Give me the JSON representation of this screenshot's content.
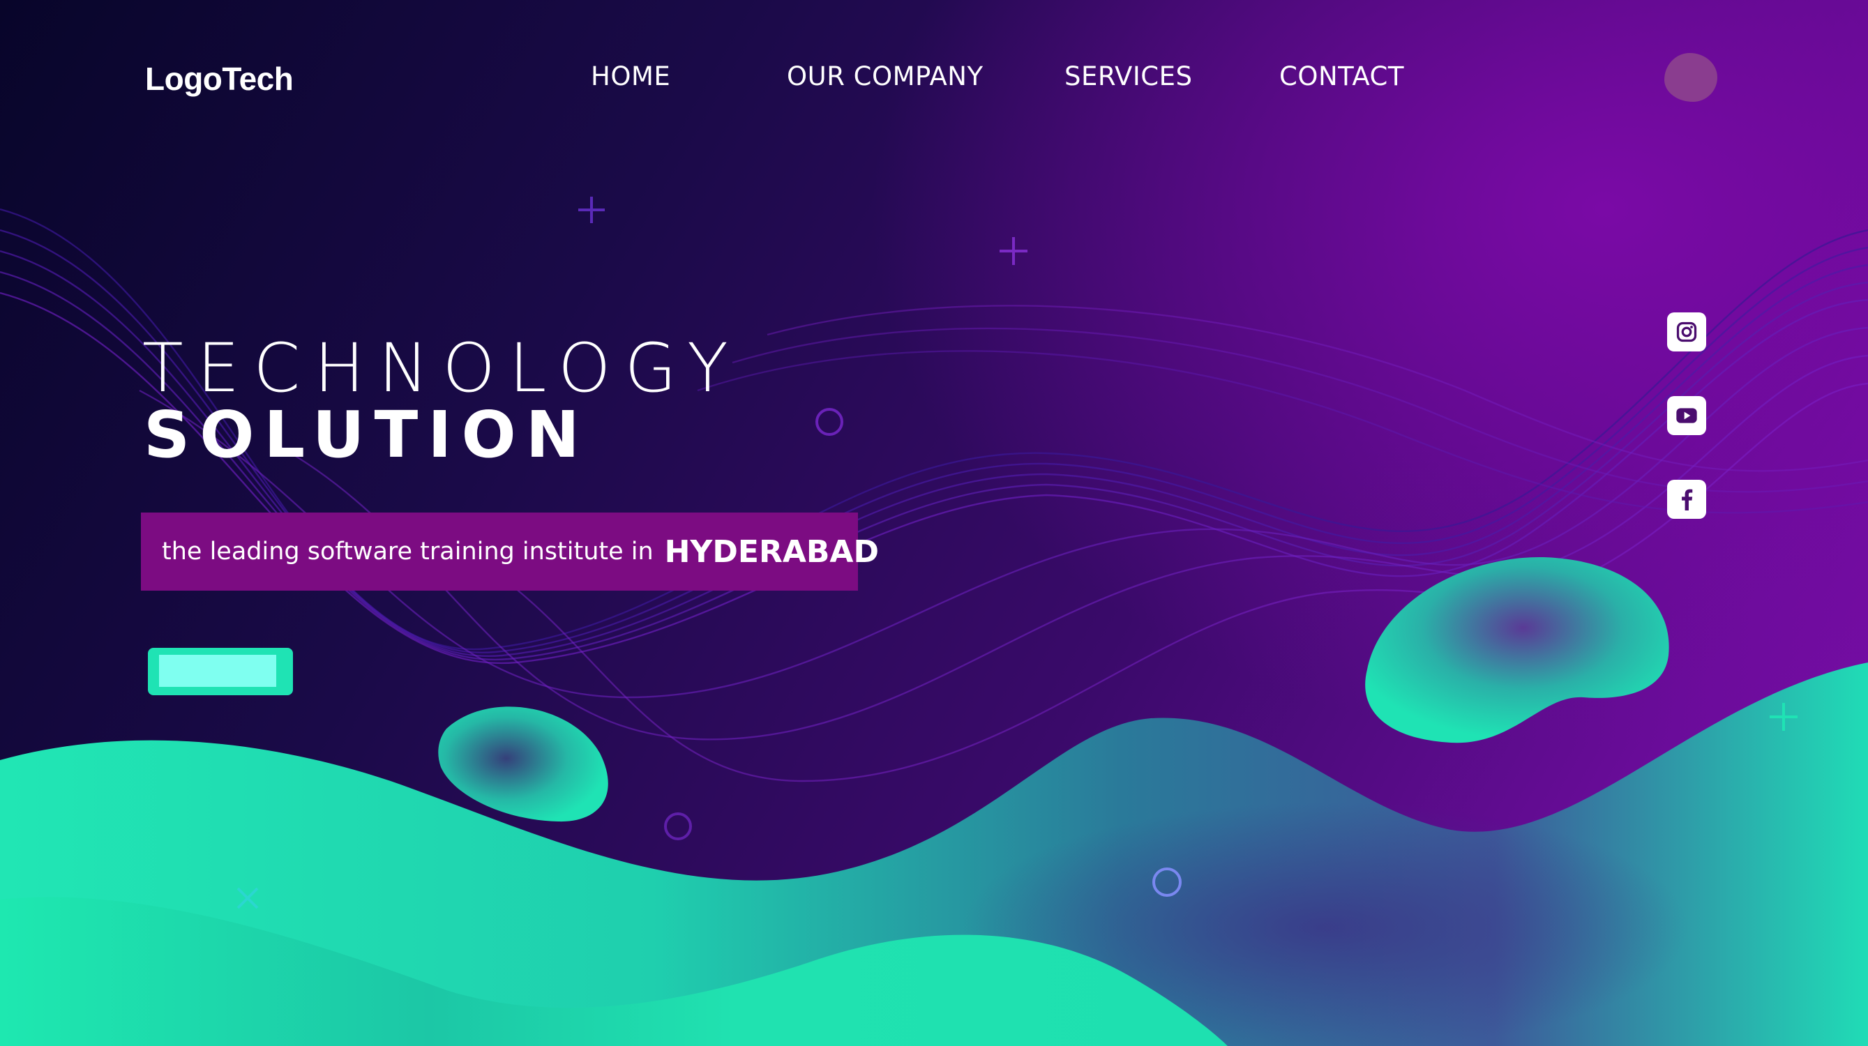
{
  "brand": {
    "logo_text": "LogoTech"
  },
  "nav": {
    "items": [
      {
        "label": "HOME"
      },
      {
        "label": "OUR COMPANY"
      },
      {
        "label": "SERVICES"
      },
      {
        "label": "CONTACT"
      }
    ]
  },
  "hero": {
    "title_line1": "TECHNOLOGY",
    "title_line2": "SOLUTION",
    "tagline_text": "the leading software training institute in",
    "tagline_city": "HYDERABAD",
    "cta_label": ""
  },
  "social": [
    {
      "icon": "instagram-icon"
    },
    {
      "icon": "youtube-icon"
    },
    {
      "icon": "facebook-icon"
    }
  ],
  "colors": {
    "background_dark": "#08052a",
    "background_purple": "#7e0fac",
    "wave_green": "#1fe3b4",
    "tagline_bg": "#7c0c82",
    "cta_inner": "#7ffff0"
  }
}
